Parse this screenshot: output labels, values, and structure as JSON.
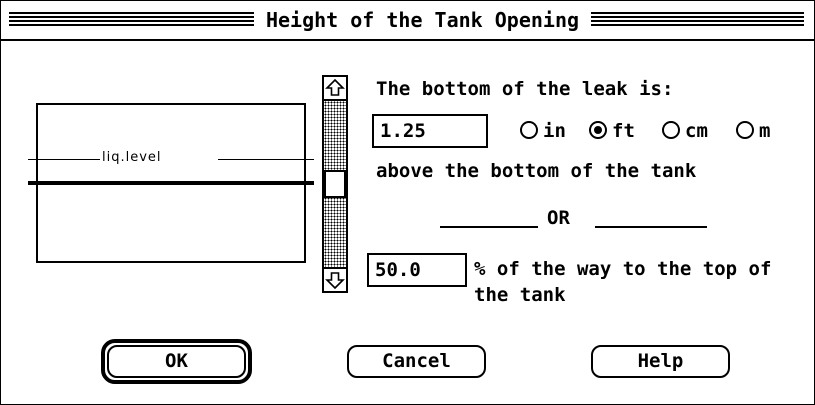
{
  "window": {
    "title": "Height of the Tank Opening"
  },
  "graph": {
    "level_label": "liq.level"
  },
  "leak": {
    "heading": "The bottom of the leak is:",
    "value": "1.25",
    "units": [
      {
        "label": "in",
        "selected": false
      },
      {
        "label": "ft",
        "selected": true
      },
      {
        "label": "cm",
        "selected": false
      },
      {
        "label": "m",
        "selected": false
      }
    ],
    "suffix": "above the bottom of the tank"
  },
  "separator": {
    "label": "OR"
  },
  "percent": {
    "value": "50.0",
    "line1": "% of the way to the top of",
    "line2": "the tank"
  },
  "scrollbar": {
    "position_fraction": 0.5
  },
  "buttons": {
    "ok": "OK",
    "cancel": "Cancel",
    "help": "Help"
  }
}
